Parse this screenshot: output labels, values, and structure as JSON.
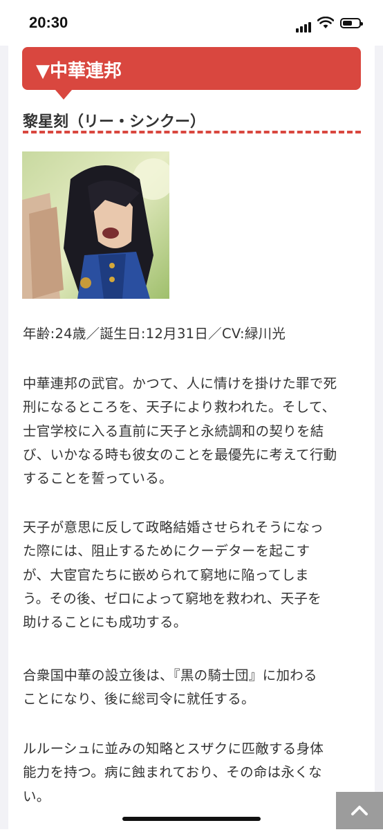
{
  "status_bar": {
    "time": "20:30",
    "signal_icon": "cellular-signal-icon",
    "wifi_icon": "wifi-icon",
    "battery_icon": "battery-icon",
    "battery_level": 0.6
  },
  "section": {
    "title": "▼中華連邦"
  },
  "character": {
    "name": "黎星刻（リー・シンクー）",
    "portrait_icon": "character-portrait-image",
    "profile": "年齢:24歳／誕生日:12月31日／CV:緑川光",
    "paragraphs": [
      [
        "中華連邦の武官。かつて、人に情けを掛けた罪で死",
        "刑になるところを、天子により救われた。そして、",
        "士官学校に入る直前に天子と永続調和の契りを結",
        "び、いかなる時も彼女のことを最優先に考えて行動",
        "することを誓っている。"
      ],
      [
        "天子が意思に反して政略結婚させられそうになっ",
        "た際には、阻止するためにクーデターを起こす",
        "が、大宦官たちに嵌められて窮地に陥ってしま",
        "う。その後、ゼロによって窮地を救われ、天子を",
        "助けることにも成功する。"
      ],
      [
        "合衆国中華の設立後は、『黒の騎士団』に加わる",
        "ことになり、後に総司令に就任する。"
      ],
      [
        "ルルーシュに並みの知略とスザクに匹敵する身体",
        "能力を持つ。病に蝕まれており、その命は永くな",
        "い。"
      ]
    ]
  },
  "scroll_top_button": {
    "icon": "chevron-up-icon"
  },
  "colors": {
    "accent": "#d9473f",
    "scroll_button": "#9c9c9c"
  }
}
